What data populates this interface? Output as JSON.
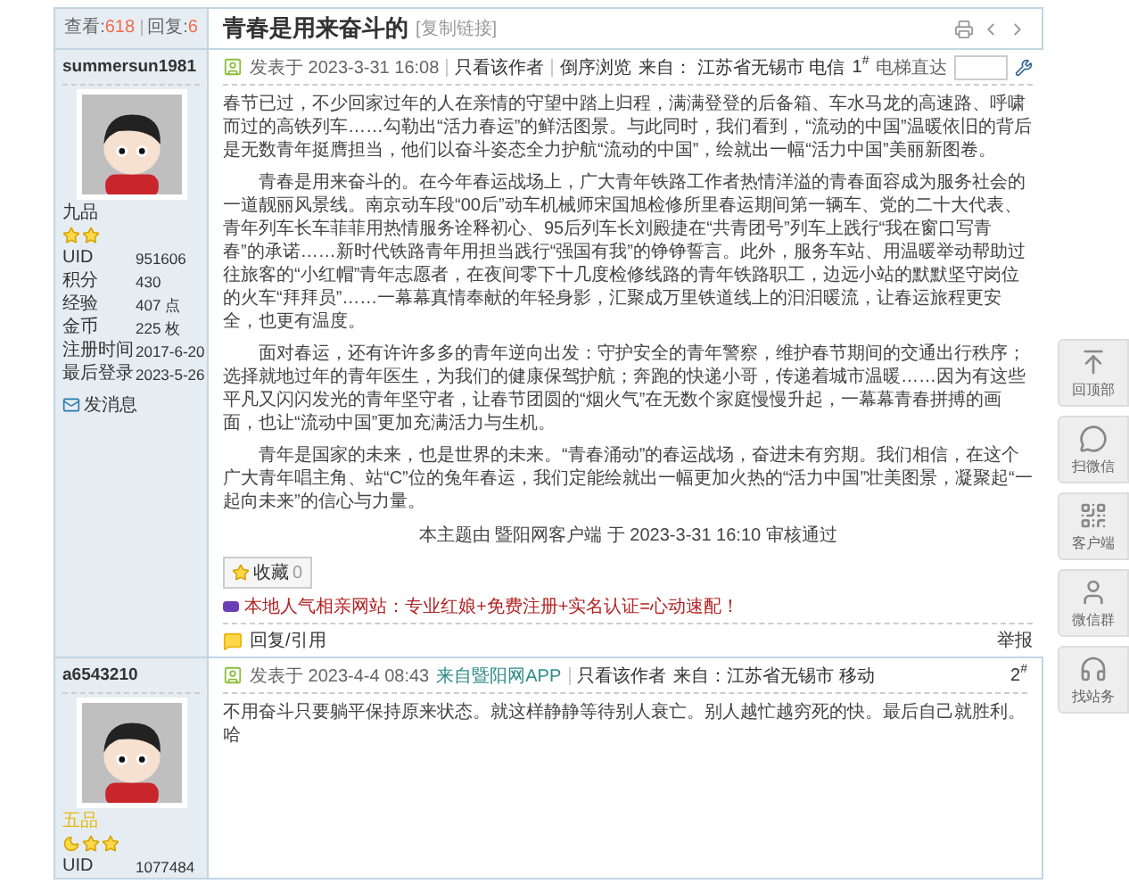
{
  "thread": {
    "views_label": "查看:",
    "views": "618",
    "replies_label": "回复:",
    "replies": "6",
    "title": "青春是用来奋斗的",
    "copy_link": "[复制链接]"
  },
  "posts": [
    {
      "author": "summersun1981",
      "rank": "九品",
      "color": "#333333",
      "badges": [
        {
          "kind": "star"
        },
        {
          "kind": "star"
        }
      ],
      "stats": [
        {
          "label": "UID",
          "value": "951606"
        },
        {
          "label": "积分",
          "value": "430"
        },
        {
          "label": "经验",
          "value": "407 点"
        },
        {
          "label": "金币",
          "value": "225 枚"
        },
        {
          "label": "注册时间",
          "value": "2017-6-20"
        },
        {
          "label": "最后登录",
          "value": "2023-5-26"
        }
      ],
      "send_message": "发消息",
      "posted_label": "发表于",
      "posted_time": "2023-3-31 16:08",
      "meta_links": [
        "只看该作者",
        "倒序浏览"
      ],
      "location": "来自：  江苏省无锡市 电信",
      "floor": "1",
      "floor_mark": "#",
      "elevator_label": "电梯直达",
      "paragraphs": [
        "春节已过，不少回家过年的人在亲情的守望中踏上归程，满满登登的后备箱、车水马龙的高速路、呼啸而过的高铁列车……勾勒出“活力春运”的鲜活图景。与此同时，我们看到，“流动的中国”温暖依旧的背后是无数青年挺膺担当，他们以奋斗姿态全力护航“流动的中国”，绘就出一幅“活力中国”美丽新图卷。",
        "　　青春是用来奋斗的。在今年春运战场上，广大青年铁路工作者热情洋溢的青春面容成为服务社会的一道靓丽风景线。南京动车段“00后”动车机械师宋国旭检修所里春运期间第一辆车、党的二十大代表、青年列车长车菲菲用热情服务诠释初心、95后列车长刘殿捷在“共青团号”列车上践行“我在窗口写青春”的承诺……新时代铁路青年用担当践行“强国有我”的铮铮誓言。此外，服务车站、用温暖举动帮助过往旅客的“小红帽”青年志愿者，在夜间零下十几度检修线路的青年铁路职工，边远小站的默默坚守岗位的火车“拜拜员”……一幕幕真情奉献的年轻身影，汇聚成万里铁道线上的汩汩暖流，让春运旅程更安全，也更有温度。",
        "　　面对春运，还有许许多多的青年逆向出发：守护安全的青年警察，维护春节期间的交通出行秩序；选择就地过年的青年医生，为我们的健康保驾护航；奔跑的快递小哥，传递着城市温暖……因为有这些平凡又闪闪发光的青年坚守者，让春节团圆的“烟火气”在无数个家庭慢慢升起，一幕幕青春拼搏的画面，也让“流动中国”更加充满活力与生机。",
        "　　青年是国家的未来，也是世界的未来。“青春涌动”的春运战场，奋进未有穷期。我们相信，在这个广大青年唱主角、站“C”位的兔年春运，我们定能绘就出一幅更加火热的“活力中国”壮美图景，凝聚起“一起向未来”的信心与力量。"
      ],
      "approval": "本主题由 暨阳网客户端 于 2023-3-31 16:10 审核通过",
      "favorite": {
        "label": "收藏",
        "count": "0"
      },
      "ad": "本地人气相亲网站：专业红娘+免费注册+实名认证=心动速配！",
      "reply_link": "回复/引用",
      "report_link": "举报"
    },
    {
      "author": "a6543210",
      "rank": "五品",
      "color": "#e8b810",
      "badges": [
        {
          "kind": "moon"
        },
        {
          "kind": "star"
        },
        {
          "kind": "star"
        }
      ],
      "stats": [
        {
          "label": "UID",
          "value": "1077484"
        }
      ],
      "posted_label": "发表于",
      "posted_time": "2023-4-4 08:43",
      "source_link": "来自暨阳网APP",
      "meta_links": [
        "只看该作者"
      ],
      "location": "来自：江苏省无锡市 移动",
      "floor": "2",
      "floor_mark": "#",
      "paragraphs": [
        "不用奋斗只要躺平保持原来状态。就这样静静等待别人衰亡。别人越忙越穷死的快。最后自己就胜利。哈"
      ]
    }
  ],
  "side_tools": [
    {
      "kind": "top",
      "label": "回顶部"
    },
    {
      "kind": "wechat",
      "label": "扫微信"
    },
    {
      "kind": "qr",
      "label": "客户端"
    },
    {
      "kind": "group",
      "label": "微信群"
    },
    {
      "kind": "support",
      "label": "找站务"
    }
  ]
}
